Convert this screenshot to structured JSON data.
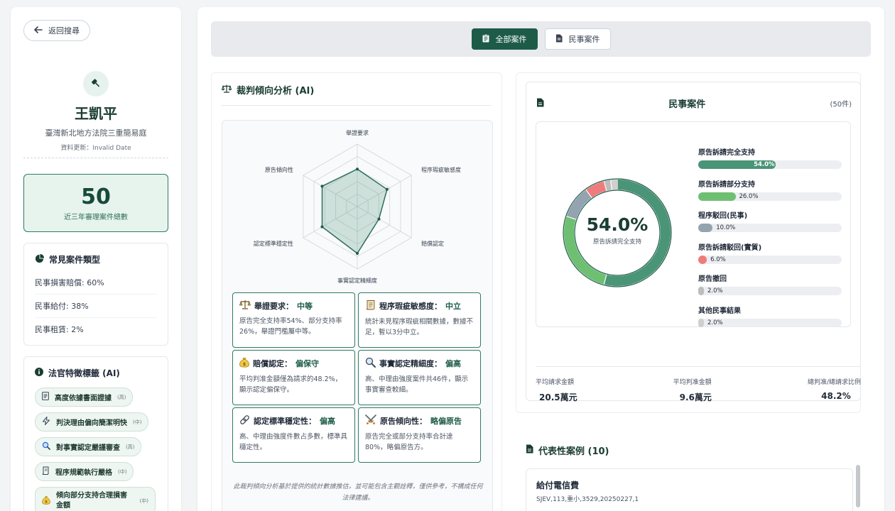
{
  "sidebar": {
    "back_label": "返回搜尋",
    "judge_name": "王凱平",
    "court": "臺灣新北地方法院三重簡易庭",
    "updated": "資料更新：Invalid Date",
    "total_count": "50",
    "total_label": "近三年審理案件總數",
    "case_types_title": "常見案件類型",
    "case_types": [
      "民事損害賠償: 60%",
      "民事給付: 38%",
      "民事租賃: 2%"
    ],
    "tags_title": "法官特徵標籤 (AI)",
    "tags": [
      {
        "label": "高度依據書面證據",
        "level": "(高)",
        "icon": "document-icon"
      },
      {
        "label": "判決理由偏向簡潔明快",
        "level": "(中)",
        "icon": "bolt-icon"
      },
      {
        "label": "對事實認定嚴謹審查",
        "level": "(高)",
        "icon": "magnifier-icon"
      },
      {
        "label": "程序規範執行嚴格",
        "level": "(中)",
        "icon": "scroll-icon"
      },
      {
        "label": "傾向部分支持合理損害金額",
        "level": "(中)",
        "icon": "money-bag-icon"
      }
    ]
  },
  "filters": {
    "all_cases": "全部案件",
    "civil_cases": "民事案件"
  },
  "analysis": {
    "title": "裁判傾向分析 (AI)",
    "radar_axes": [
      "舉證要求",
      "程序瑕疵敏感度",
      "賠償認定",
      "事實認定精細度",
      "認定標準穩定性",
      "原告傾向性"
    ],
    "radar_values": [
      0.6,
      0.55,
      0.4,
      0.75,
      0.65,
      0.65
    ],
    "metrics": [
      {
        "title": "舉證要求：",
        "value": "中等",
        "desc": "原告完全支持率54%、部分支持率26%，舉證門檻屬中等。",
        "icon": "scales-icon"
      },
      {
        "title": "程序瑕疵敏感度：",
        "value": "中立",
        "desc": "統計未見程序瑕疵相關數據，數據不足，暫以3分中立。",
        "icon": "scroll-icon"
      },
      {
        "title": "賠償認定：",
        "value": "偏保守",
        "desc": "平均判准金額僅為請求的48.2%，顯示認定偏保守。",
        "icon": "money-bag-icon"
      },
      {
        "title": "事實認定精細度：",
        "value": "偏高",
        "desc": "高、中理由強度案件共46件，顯示事實審查較細。",
        "icon": "magnifier-icon"
      },
      {
        "title": "認定標準穩定性：",
        "value": "偏高",
        "desc": "高、中理由強度件數占多數，標準具穩定性。",
        "icon": "link-icon"
      },
      {
        "title": "原告傾向性：",
        "value": "略偏原告",
        "desc": "原告完全或部分支持率合計達80%，略偏原告方。",
        "icon": "swords-icon"
      }
    ],
    "disclaimer": "此裁判傾向分析基於提供的統計數據推估，並可能包含主觀詮釋，僅供參考，不構成任何法律建議。"
  },
  "civil": {
    "title": "民事案件",
    "count": "(50件)",
    "center_pct": "54.0%",
    "center_label": "原告訴請完全支持",
    "stats": [
      {
        "label": "平均請求金額",
        "value": "20.5萬元"
      },
      {
        "label": "平均判准金額",
        "value": "9.6萬元"
      },
      {
        "label": "總判准/總請求比例",
        "value": "48.2%"
      }
    ]
  },
  "chart_data": {
    "type": "pie",
    "title": "民事案件",
    "categories": [
      "原告訴請完全支持",
      "原告訴請部分支持",
      "程序駁回(民事)",
      "原告訴請駁回(實質)",
      "原告撤回",
      "其他民事結果"
    ],
    "values": [
      54.0,
      26.0,
      10.0,
      6.0,
      2.0,
      2.0
    ],
    "labels": [
      "54.0%",
      "26.0%",
      "10.0%",
      "6.0%",
      "2.0%",
      "2.0%"
    ],
    "colors": [
      "#4a9478",
      "#6fbf73",
      "#94a3b0",
      "#ef7c7c",
      "#bdbdbd",
      "#cfcfcf"
    ]
  },
  "representative": {
    "title": "代表性案例 (10)",
    "cases": [
      {
        "name": "給付電信費",
        "code": "SJEV,113,重小,3529,20250227,1"
      }
    ]
  },
  "colors": {
    "primary": "#1d5b48",
    "accent_light": "#e7f4ee"
  }
}
